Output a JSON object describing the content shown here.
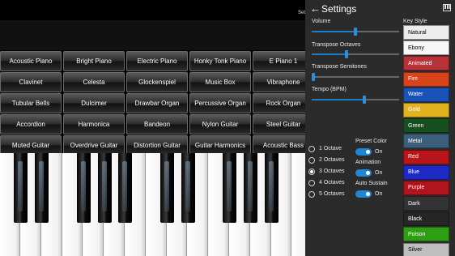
{
  "topbar": {
    "settings_shortcut": "Set"
  },
  "instruments": [
    [
      "Acoustic Piano",
      "Bright Piano",
      "Electric Piano",
      "Honky Tonk Piano",
      "E Piano 1"
    ],
    [
      "Clavinet",
      "Celesta",
      "Glockenspiel",
      "Music Box",
      "Vibraphone"
    ],
    [
      "Tubular Bells",
      "Dulcimer",
      "Drawbar Organ",
      "Percussive Organ",
      "Rock Organ"
    ],
    [
      "Accordion",
      "Harmonica",
      "Bandeon",
      "Nylon Guitar",
      "Steel Guitar"
    ],
    [
      "Muted Guitar",
      "Overdrive Guitar",
      "Distortion Guitar",
      "Guitar Harmonics",
      "Acoustic Bass"
    ]
  ],
  "settings": {
    "title": "Settings",
    "volume": {
      "label": "Volume",
      "value": 0.5
    },
    "transpose_octaves": {
      "label": "Transpose Octaves",
      "value": 0.4
    },
    "transpose_semitones": {
      "label": "Transpose Semitones",
      "value": 0.0
    },
    "tempo": {
      "label": "Tempo (BPM)",
      "value": 0.6
    },
    "octaves": {
      "options": [
        "1 Octave",
        "2 Octaves",
        "3 Octaves",
        "4 Octaves",
        "5 Octaves"
      ],
      "selected": "3 Octaves"
    },
    "preset_color": {
      "label": "Preset Color",
      "state": "On"
    },
    "animation": {
      "label": "Animation",
      "state": "On"
    },
    "auto_sustain": {
      "label": "Auto Sustain",
      "state": "On"
    },
    "key_style": {
      "label": "Key Style",
      "options": [
        {
          "name": "Natural",
          "bg": "#ececec",
          "fg": "#000"
        },
        {
          "name": "Ebony",
          "bg": "#f7f7f7",
          "fg": "#000"
        },
        {
          "name": "Animated",
          "bg": "#b8323a",
          "fg": "#fff"
        },
        {
          "name": "Fire",
          "bg": "#d9431a",
          "fg": "#fff"
        },
        {
          "name": "Water",
          "bg": "#1a52b8",
          "fg": "#fff"
        },
        {
          "name": "Gold",
          "bg": "#e2b21f",
          "fg": "#fff"
        },
        {
          "name": "Green",
          "bg": "#16501e",
          "fg": "#fff"
        },
        {
          "name": "Metal",
          "bg": "#3a5f7a",
          "fg": "#fff"
        },
        {
          "name": "Red",
          "bg": "#b8161b",
          "fg": "#fff"
        },
        {
          "name": "Blue",
          "bg": "#1f29c4",
          "fg": "#fff"
        },
        {
          "name": "Purple",
          "bg": "#b0141c",
          "fg": "#fff"
        },
        {
          "name": "Dark",
          "bg": "#333333",
          "fg": "#fff"
        },
        {
          "name": "Black",
          "bg": "#262626",
          "fg": "#fff"
        },
        {
          "name": "Poison",
          "bg": "#2e9e13",
          "fg": "#fff"
        },
        {
          "name": "Silver",
          "bg": "#bfbfbf",
          "fg": "#000"
        }
      ]
    }
  }
}
